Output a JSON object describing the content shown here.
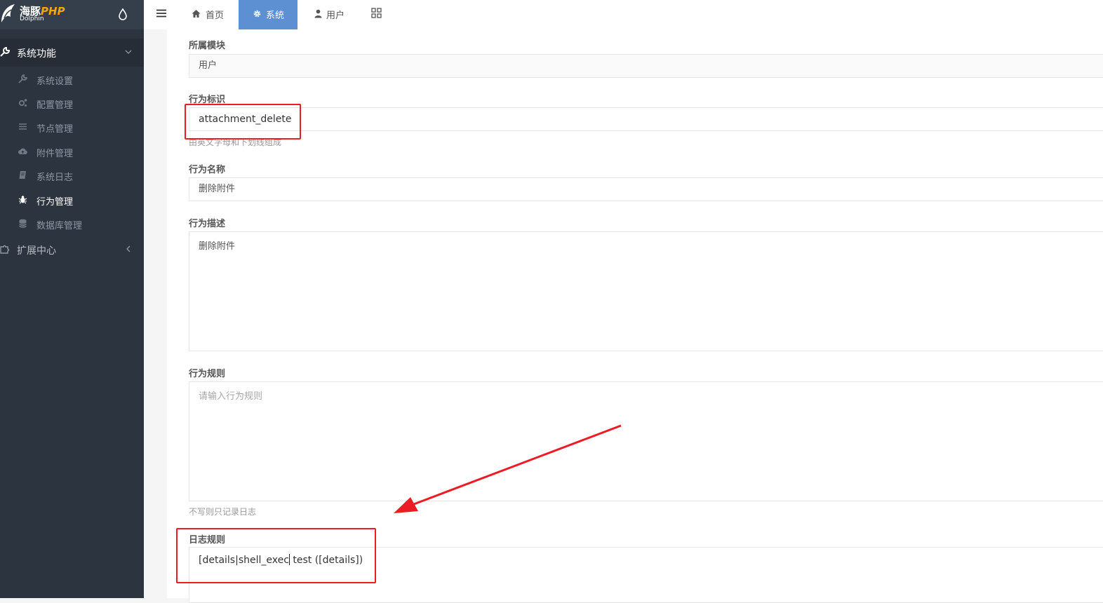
{
  "brand": {
    "name_cn": "海豚",
    "name_php": "PHP",
    "sub": "Dolphin"
  },
  "sidebar": {
    "group1": {
      "label": "系统功能",
      "icon": "wrench-icon"
    },
    "items": [
      {
        "label": "系统设置",
        "icon": "wrench-icon"
      },
      {
        "label": "配置管理",
        "icon": "gears-icon"
      },
      {
        "label": "节点管理",
        "icon": "list-icon"
      },
      {
        "label": "附件管理",
        "icon": "cloud-upload-icon"
      },
      {
        "label": "系统日志",
        "icon": "book-icon"
      },
      {
        "label": "行为管理",
        "icon": "bug-icon",
        "active": true
      },
      {
        "label": "数据库管理",
        "icon": "database-icon"
      }
    ],
    "group2": {
      "label": "扩展中心",
      "icon": "puzzle-icon"
    }
  },
  "topbar": {
    "tabs": [
      {
        "label": "首页",
        "icon": "home-icon"
      },
      {
        "label": "系统",
        "icon": "gear-icon",
        "active": true
      },
      {
        "label": "用户",
        "icon": "user-icon"
      }
    ]
  },
  "form": {
    "module": {
      "label": "所属模块",
      "value": "用户"
    },
    "identifier": {
      "label": "行为标识",
      "value": "attachment_delete",
      "help": "由英文字母和下划线组成"
    },
    "name": {
      "label": "行为名称",
      "value": "删除附件"
    },
    "description": {
      "label": "行为描述",
      "value": "删除附件"
    },
    "rule": {
      "label": "行为规则",
      "placeholder": "请输入行为规则",
      "help": "不写则只记录日志"
    },
    "log_rule": {
      "label": "日志规则",
      "value_before_caret": "[details|shell_exec",
      "value_after_caret": " test ([details])"
    }
  },
  "colors": {
    "sidebar": "#2c343f",
    "accent": "#5c90d2",
    "annotation": "#ec1c24"
  }
}
